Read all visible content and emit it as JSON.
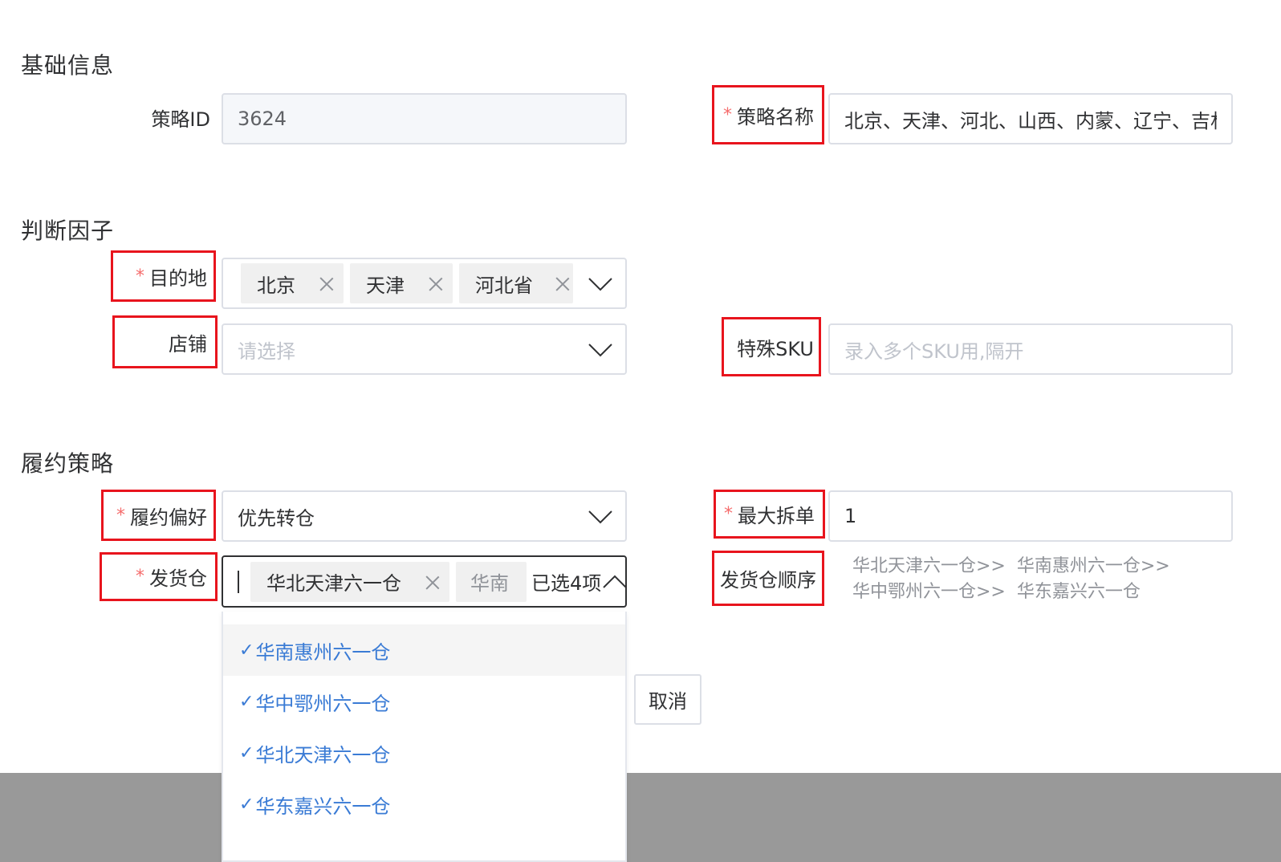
{
  "sections": {
    "basic": "基础信息",
    "factors": "判断因子",
    "fulfillment": "履约策略"
  },
  "basic": {
    "strategy_id_label": "策略ID",
    "strategy_id_value": "3624",
    "strategy_name_label": "策略名称",
    "strategy_name_value": "北京、天津、河北、山西、内蒙、辽宁、吉林"
  },
  "factors": {
    "destination_label": "目的地",
    "destination_tags": [
      "北京",
      "天津",
      "河北省"
    ],
    "shop_label": "店铺",
    "shop_placeholder": "请选择",
    "special_sku_label": "特殊SKU",
    "special_sku_placeholder": "录入多个SKU用,隔开"
  },
  "fulfillment": {
    "preference_label": "履约偏好",
    "preference_value": "优先转仓",
    "max_split_label": "最大拆单",
    "max_split_value": "1",
    "warehouse_label": "发货仓",
    "warehouse_tag": "华北天津六一仓",
    "warehouse_tag_partial": "华南",
    "warehouse_count": "已选4项",
    "order_label": "发货仓顺序",
    "order_line1": "华北天津六一仓>>  华南惠州六一仓>>",
    "order_line2": "华中鄂州六一仓>>  华东嘉兴六一仓"
  },
  "dropdown_options": [
    {
      "label": "华南惠州六一仓",
      "selected": true
    },
    {
      "label": "华中鄂州六一仓",
      "selected": true
    },
    {
      "label": "华北天津六一仓",
      "selected": true
    },
    {
      "label": "华东嘉兴六一仓",
      "selected": true
    }
  ],
  "check_glyph": "✓",
  "cancel_button": "取消",
  "colors": {
    "required_star": "#f56c6c",
    "highlight_box": "#e8141d",
    "option_text": "#3a7bd5",
    "footer_bar": "#999999"
  }
}
